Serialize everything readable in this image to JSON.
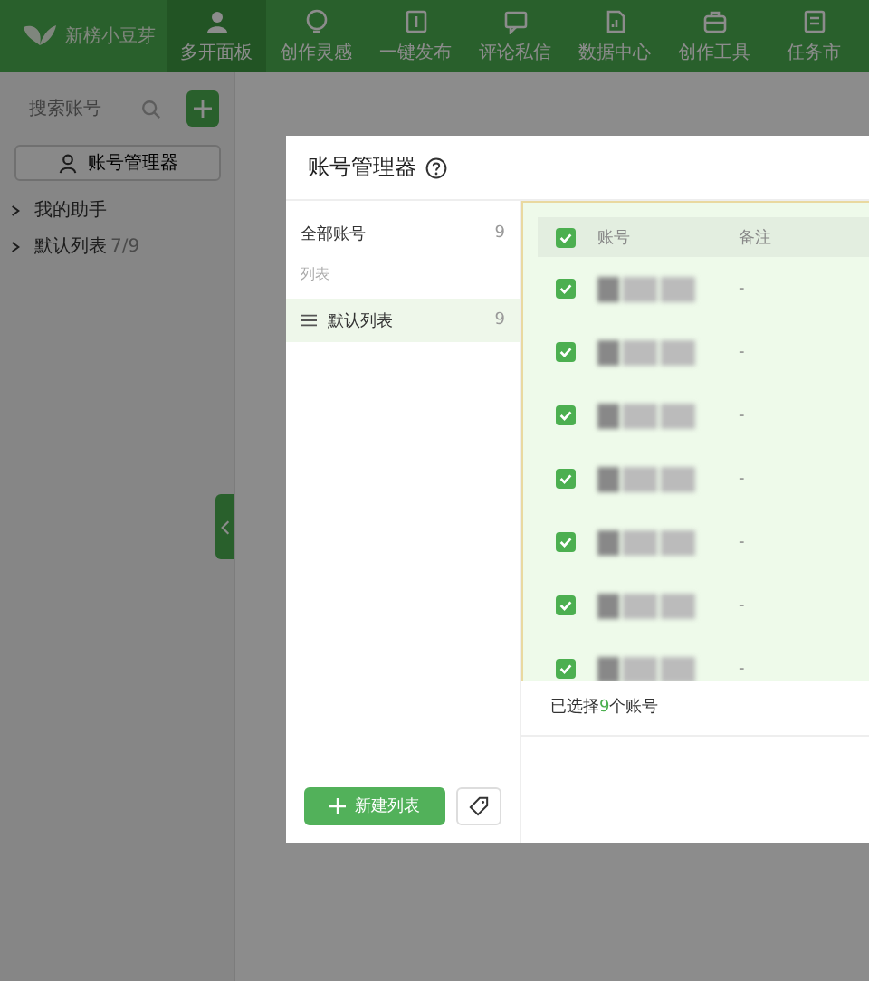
{
  "app": {
    "name": "新榜小豆芽"
  },
  "nav": [
    {
      "label": "多开面板",
      "selected": true
    },
    {
      "label": "创作灵感",
      "selected": false
    },
    {
      "label": "一键发布",
      "selected": false
    },
    {
      "label": "评论私信",
      "selected": false
    },
    {
      "label": "数据中心",
      "selected": false
    },
    {
      "label": "创作工具",
      "selected": false
    },
    {
      "label": "任务市",
      "selected": false
    }
  ],
  "sidebar": {
    "search": {
      "placeholder": "搜索账号"
    },
    "manager_button": "账号管理器",
    "tree": [
      {
        "label": "我的助手",
        "expanded": false
      },
      {
        "label": "默认列表",
        "count": "7/9",
        "expanded": false
      }
    ]
  },
  "dialog": {
    "title": "账号管理器",
    "all_accounts": {
      "label": "全部账号",
      "count": "9"
    },
    "lists_heading": "列表",
    "lists": [
      {
        "label": "默认列表",
        "count": "9",
        "selected": true
      }
    ],
    "new_list_button": "新建列表",
    "table": {
      "all_checked": true,
      "columns": [
        "账号",
        "备注"
      ],
      "rows": [
        {
          "checked": true,
          "remark": "-"
        },
        {
          "checked": true,
          "remark": "-"
        },
        {
          "checked": true,
          "remark": "-"
        },
        {
          "checked": true,
          "remark": "-"
        },
        {
          "checked": true,
          "remark": "-"
        },
        {
          "checked": true,
          "remark": "-"
        },
        {
          "checked": true,
          "remark": "-"
        }
      ]
    },
    "selection_summary": {
      "prefix": "已选择",
      "count": "9",
      "suffix": "个账号"
    }
  }
}
